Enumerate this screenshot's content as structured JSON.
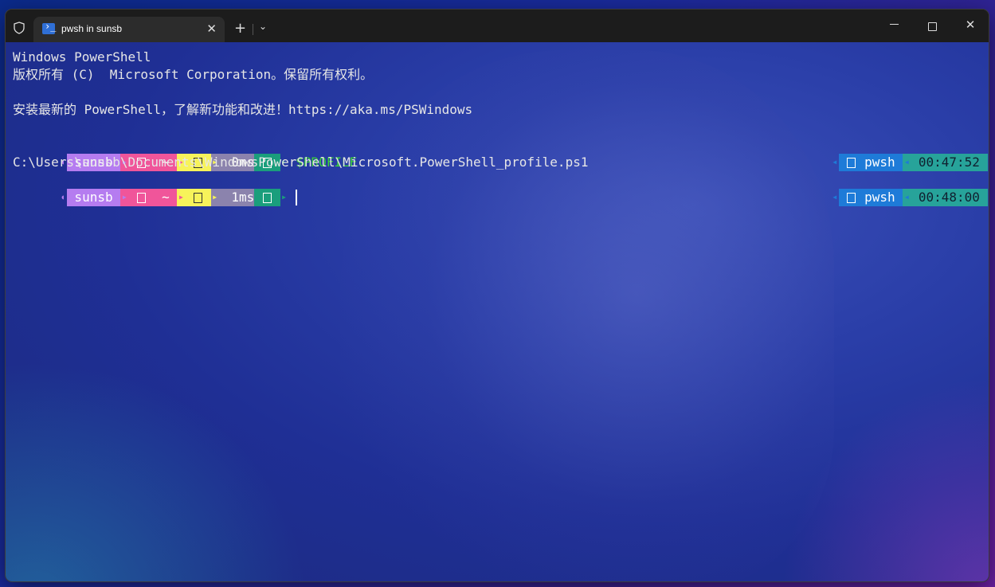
{
  "tab": {
    "title": "pwsh in sunsb",
    "close": "✕"
  },
  "titlebar": {
    "new_tab": "+",
    "dropdown": "⌄",
    "close": "✕"
  },
  "terminal": {
    "line1": "Windows PowerShell",
    "line2": "版权所有 (C)  Microsoft Corporation。保留所有权利。",
    "line3": "安装最新的 PowerShell，了解新功能和改进！https://aka.ms/PSWindows",
    "prompt1": {
      "user": " sunsb ",
      "path": " ~ ",
      "duration": "0ms",
      "command": "$PROFILE",
      "shell": " pwsh ",
      "time": " 00:47:52 "
    },
    "output": "C:\\Users\\sunsb\\Documents\\WindowsPowerShell\\Microsoft.PowerShell_profile.ps1",
    "prompt2": {
      "user": " sunsb ",
      "path": " ~ ",
      "duration": "1ms",
      "shell": " pwsh ",
      "time": " 00:48:00 "
    }
  },
  "colors": {
    "user_bg": "#b57cf0",
    "git_bg": "#f0559a",
    "path_bg": "#f0559a",
    "status_bg": "#f7f35a",
    "duration_bg": "#8b83ad",
    "exit_bg": "#1a9e7c",
    "command": "#3bd13b",
    "shell_bg": "#1e7bd8",
    "time_bg": "#27a39a"
  }
}
